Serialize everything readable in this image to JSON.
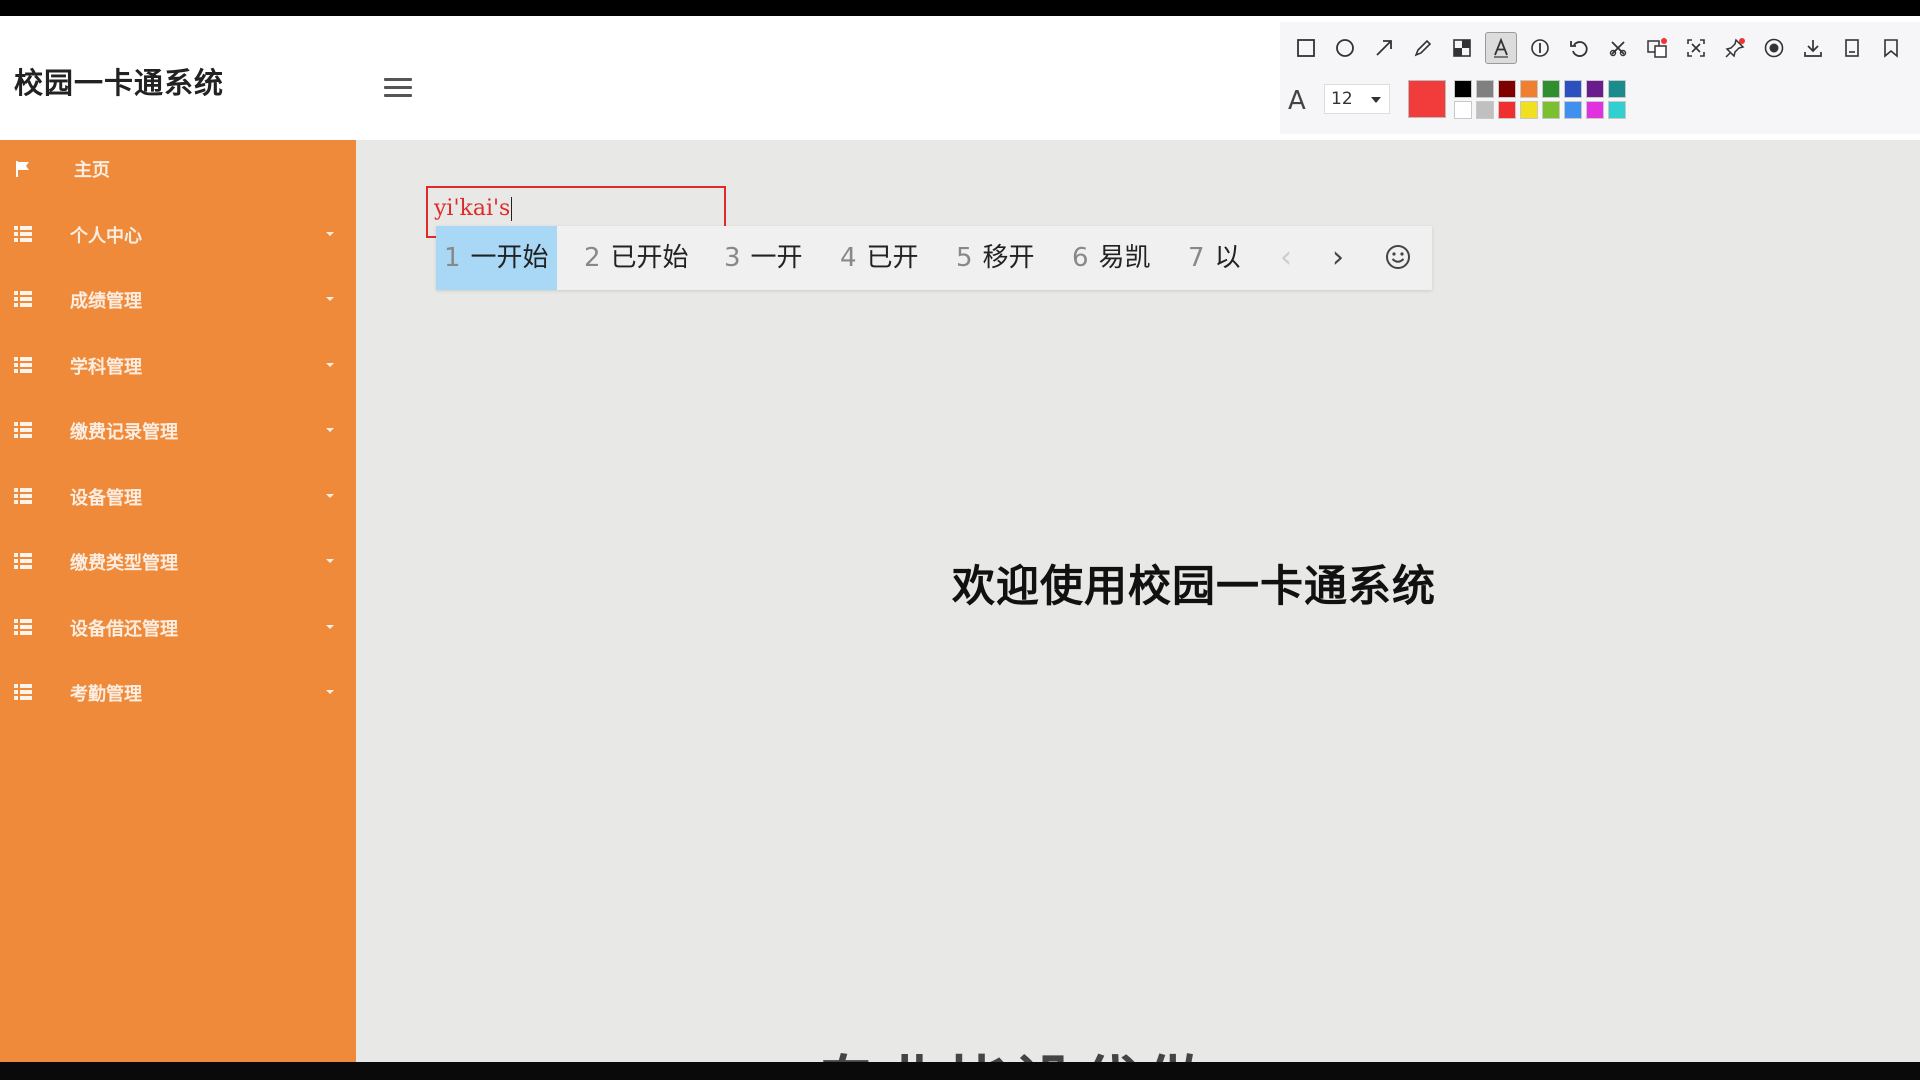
{
  "app": {
    "title": "校园一卡通系统"
  },
  "sidebar": {
    "items": [
      {
        "label": "主页",
        "icon": "flag-icon",
        "has_submenu": false
      },
      {
        "label": "个人中心",
        "icon": "grid-icon",
        "has_submenu": true
      },
      {
        "label": "成绩管理",
        "icon": "grid-icon",
        "has_submenu": true
      },
      {
        "label": "学科管理",
        "icon": "grid-icon",
        "has_submenu": true
      },
      {
        "label": "缴费记录管理",
        "icon": "grid-icon",
        "has_submenu": true
      },
      {
        "label": "设备管理",
        "icon": "grid-icon",
        "has_submenu": true
      },
      {
        "label": "缴费类型管理",
        "icon": "grid-icon",
        "has_submenu": true
      },
      {
        "label": "设备借还管理",
        "icon": "grid-icon",
        "has_submenu": true
      },
      {
        "label": "考勤管理",
        "icon": "grid-icon",
        "has_submenu": true
      }
    ]
  },
  "main": {
    "welcome": "欢迎使用校园一卡通系统",
    "bottom_partial_text": "专业毕设代做"
  },
  "annotation": {
    "text": "yi'kai's"
  },
  "ime": {
    "candidates": [
      {
        "num": "1",
        "text": "一开始",
        "selected": true
      },
      {
        "num": "2",
        "text": "已开始",
        "selected": false
      },
      {
        "num": "3",
        "text": "一开",
        "selected": false
      },
      {
        "num": "4",
        "text": "已开",
        "selected": false
      },
      {
        "num": "5",
        "text": "移开",
        "selected": false
      },
      {
        "num": "6",
        "text": "易凯",
        "selected": false
      },
      {
        "num": "7",
        "text": "以",
        "selected": false
      }
    ],
    "prev": "‹",
    "next": "›"
  },
  "toolbar": {
    "tools": [
      "rectangle-tool-icon",
      "ellipse-tool-icon",
      "arrow-tool-icon",
      "pen-tool-icon",
      "mosaic-tool-icon",
      "text-tool-icon",
      "number-marker-icon",
      "undo-icon",
      "cancel-icon",
      "translate-icon",
      "ocr-icon",
      "pin-icon",
      "record-icon",
      "download-icon",
      "save-icon",
      "bookmark-icon"
    ],
    "active_tool": "text-tool-icon",
    "font_label": "A",
    "font_size": "12",
    "current_color": "#f23b3b",
    "swatches": [
      "#000000",
      "#808080",
      "#800000",
      "#f08030",
      "#2f8f2f",
      "#2b50c0",
      "#6b1c8c",
      "#1a8c8c",
      "#ffffff",
      "#c0c0c0",
      "#f03030",
      "#f0e020",
      "#7ac030",
      "#4090f0",
      "#e030e0",
      "#30d0d0"
    ]
  },
  "colors": {
    "sidebar": "#ef8a3a",
    "main_bg": "#e8e8e6",
    "annotation": "#e02a2a",
    "ime_selected": "#a9d8f6"
  }
}
